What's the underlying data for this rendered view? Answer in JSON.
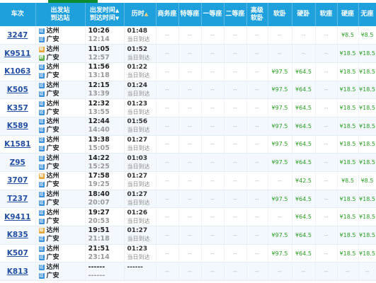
{
  "headers": {
    "train": "车次",
    "from_to": [
      "出发站",
      "到达站"
    ],
    "times": [
      "出发时间",
      "到达时间"
    ],
    "duration": "历时",
    "seats": [
      "商务座",
      "特等座",
      "一等座",
      "二等座",
      "高级\n软卧",
      "软卧",
      "硬卧",
      "软座",
      "硬座",
      "无座"
    ],
    "sort_up": "▲",
    "sort_down": "▼"
  },
  "labels": {
    "same_day": "当日到达",
    "dash": "--",
    "pass_badge": "过",
    "start_badge": "始",
    "end_badge": "终"
  },
  "colors": {
    "header_bg": "#1ea0dc",
    "price": "#2a9d22",
    "train_link": "#244fa0"
  },
  "trains": [
    {
      "no": "3247",
      "from": "达州",
      "to": "广安",
      "dep": "10:26",
      "arr": "12:14",
      "dur": "01:48",
      "from_badge": "pass",
      "to_badge": "pass",
      "seats": [
        "--",
        "--",
        "--",
        "--",
        "--",
        "--",
        "--",
        "--",
        "¥8.5",
        "¥8.5"
      ]
    },
    {
      "no": "K9511",
      "from": "达州",
      "to": "广安",
      "dep": "11:05",
      "arr": "12:57",
      "dur": "01:52",
      "from_badge": "start",
      "to_badge": "end",
      "seats": [
        "--",
        "--",
        "--",
        "--",
        "--",
        "--",
        "--",
        "--",
        "¥18.5",
        "¥18.5"
      ]
    },
    {
      "no": "K1063",
      "from": "达州",
      "to": "广安",
      "dep": "11:56",
      "arr": "13:18",
      "dur": "01:22",
      "from_badge": "pass",
      "to_badge": "pass",
      "seats": [
        "--",
        "--",
        "--",
        "--",
        "--",
        "¥97.5",
        "¥64.5",
        "--",
        "¥18.5",
        "¥18.5"
      ]
    },
    {
      "no": "K505",
      "from": "达州",
      "to": "广安",
      "dep": "12:15",
      "arr": "13:39",
      "dur": "01:24",
      "from_badge": "pass",
      "to_badge": "pass",
      "seats": [
        "--",
        "--",
        "--",
        "--",
        "--",
        "¥97.5",
        "¥64.5",
        "--",
        "¥18.5",
        "¥18.5"
      ]
    },
    {
      "no": "K357",
      "from": "达州",
      "to": "广安",
      "dep": "12:32",
      "arr": "13:55",
      "dur": "01:23",
      "from_badge": "pass",
      "to_badge": "pass",
      "seats": [
        "--",
        "--",
        "--",
        "--",
        "--",
        "¥97.5",
        "¥64.5",
        "--",
        "¥18.5",
        "¥18.5"
      ]
    },
    {
      "no": "K589",
      "from": "达州",
      "to": "广安",
      "dep": "12:44",
      "arr": "14:40",
      "dur": "01:56",
      "from_badge": "pass",
      "to_badge": "pass",
      "seats": [
        "--",
        "--",
        "--",
        "--",
        "--",
        "¥97.5",
        "¥64.5",
        "--",
        "¥18.5",
        "¥18.5"
      ]
    },
    {
      "no": "K1581",
      "from": "达州",
      "to": "广安",
      "dep": "13:38",
      "arr": "15:05",
      "dur": "01:27",
      "from_badge": "pass",
      "to_badge": "pass",
      "seats": [
        "--",
        "--",
        "--",
        "--",
        "--",
        "¥97.5",
        "¥64.5",
        "--",
        "¥18.5",
        "¥18.5"
      ]
    },
    {
      "no": "Z95",
      "from": "达州",
      "to": "广安",
      "dep": "14:22",
      "arr": "15:25",
      "dur": "01:03",
      "from_badge": "pass",
      "to_badge": "pass",
      "seats": [
        "--",
        "--",
        "--",
        "--",
        "--",
        "¥97.5",
        "¥64.5",
        "--",
        "¥18.5",
        "¥18.5"
      ]
    },
    {
      "no": "3707",
      "from": "达州",
      "to": "广安",
      "dep": "17:58",
      "arr": "19:25",
      "dur": "01:27",
      "from_badge": "start",
      "to_badge": "pass",
      "seats": [
        "--",
        "--",
        "--",
        "--",
        "--",
        "--",
        "¥42.5",
        "--",
        "¥8.5",
        "¥8.5"
      ]
    },
    {
      "no": "T237",
      "from": "达州",
      "to": "广安",
      "dep": "18:40",
      "arr": "20:07",
      "dur": "01:27",
      "from_badge": "pass",
      "to_badge": "pass",
      "seats": [
        "--",
        "--",
        "--",
        "--",
        "--",
        "¥97.5",
        "¥64.5",
        "--",
        "¥18.5",
        "¥18.5"
      ]
    },
    {
      "no": "K9411",
      "from": "达州",
      "to": "广安",
      "dep": "19:27",
      "arr": "20:53",
      "dur": "01:26",
      "from_badge": "pass",
      "to_badge": "pass",
      "seats": [
        "--",
        "--",
        "--",
        "--",
        "--",
        "--",
        "¥64.5",
        "--",
        "¥18.5",
        "¥18.5"
      ]
    },
    {
      "no": "K835",
      "from": "达州",
      "to": "广安",
      "dep": "19:51",
      "arr": "21:18",
      "dur": "01:27",
      "from_badge": "start",
      "to_badge": "pass",
      "seats": [
        "--",
        "--",
        "--",
        "--",
        "--",
        "¥97.5",
        "¥64.5",
        "--",
        "¥18.5",
        "¥18.5"
      ]
    },
    {
      "no": "K507",
      "from": "达州",
      "to": "广安",
      "dep": "21:51",
      "arr": "23:14",
      "dur": "01:23",
      "from_badge": "pass",
      "to_badge": "pass",
      "seats": [
        "--",
        "--",
        "--",
        "--",
        "--",
        "¥97.5",
        "¥64.5",
        "--",
        "¥18.5",
        "¥18.5"
      ]
    },
    {
      "no": "K813",
      "from": "达州",
      "to": "广安",
      "dep": "------",
      "arr": "------",
      "dur": "------",
      "no_sale": true,
      "from_badge": "pass",
      "to_badge": "pass",
      "seats": [
        "--",
        "--",
        "--",
        "--",
        "--",
        "--",
        "--",
        "--",
        "--",
        "--"
      ]
    }
  ]
}
